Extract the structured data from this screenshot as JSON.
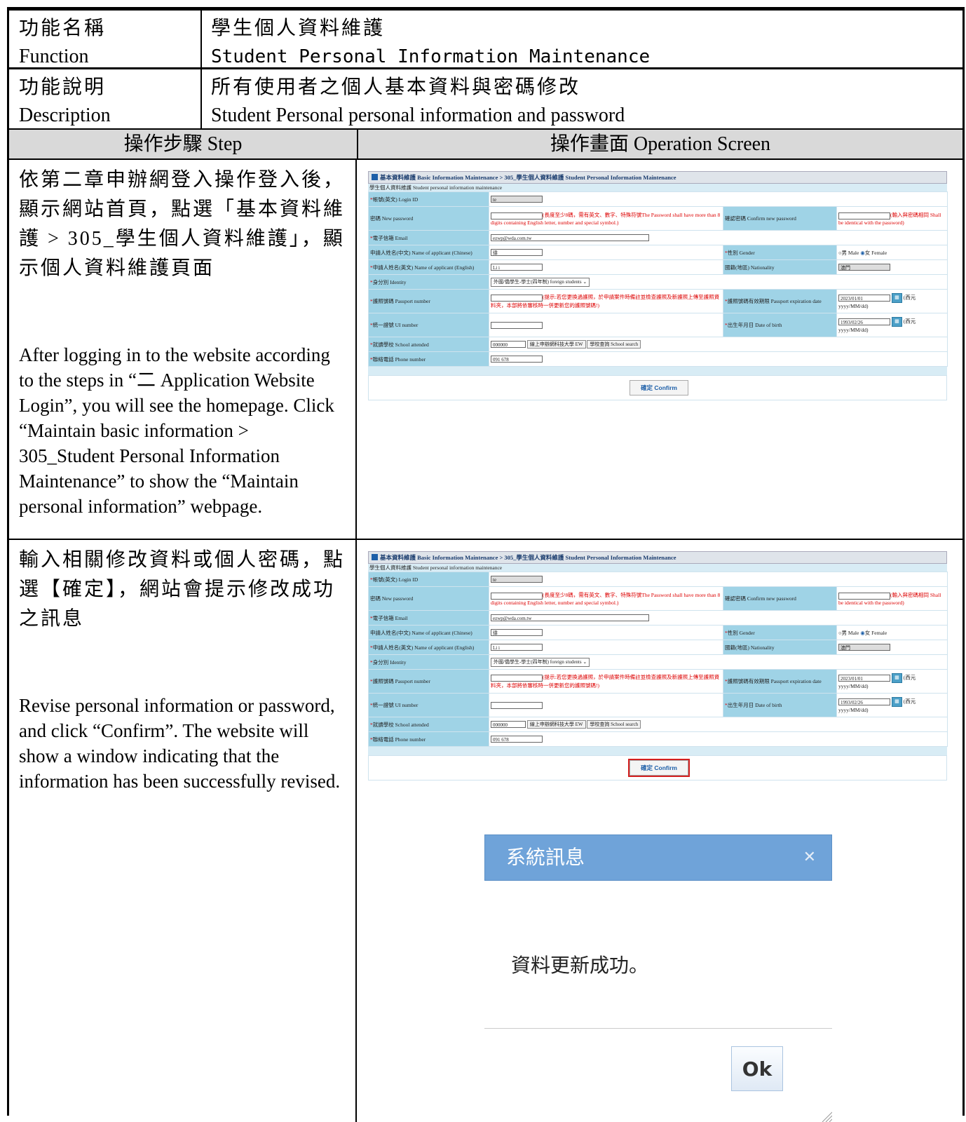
{
  "header": {
    "func_name_label_zh": "功能名稱",
    "func_name_label_en": "Function",
    "func_name_zh": "學生個人資料維護",
    "func_name_en": "Student Personal Information Maintenance",
    "desc_label_zh": "功能說明",
    "desc_label_en": "Description",
    "desc_zh": "所有使用者之個人基本資料與密碼修改",
    "desc_en": "Student Personal personal information and password"
  },
  "columns": {
    "step": "操作步驟 Step",
    "screen": "操作畫面 Operation Screen"
  },
  "steps": [
    {
      "zh": "依第二章申辦網登入操作登入後，顯示網站首頁，點選「基本資料維護 > 305_學生個人資料維護」，顯示個人資料維護頁面",
      "en": "After logging in to the website according to the steps in “二 Application Website Login”, you will see the homepage. Click “Maintain basic information > 305_Student Personal Information Maintenance” to show the “Maintain personal information” webpage."
    },
    {
      "zh": "輸入相關修改資料或個人密碼，點選【確定】，網站會提示修改成功之訊息",
      "en": "Revise personal information or password, and click “Confirm”. The website will show a window indicating that the information has been successfully revised."
    }
  ],
  "form": {
    "breadcrumb": "基本資料維護 Basic Information Maintenance > 305_學生個人資料維護 Student Personal Information Maintenance",
    "subtitle": "學生個人資料維護 Student personal information maintenance",
    "login_id_label": "帳號(英文) Login ID",
    "login_id_value": "te",
    "new_password_label": "密碼 New password",
    "password_hint": "(長度至少8碼，需有英文、數字、特殊符號The Password shall have more than 8 digits containing English letter, number and special symbol.)",
    "confirm_password_label": "確認密碼 Confirm new password",
    "confirm_password_hint": "(輸入與密碼相同 Shall be identical with the password)",
    "email_label": "電子信箱 Email",
    "email_value": "ezwp@wda.com.tw",
    "name_zh_label": "申請人姓名(中文) Name of applicant (Chinese)",
    "name_zh_value": "徫",
    "gender_label": "性別 Gender",
    "gender_male": "男 Male",
    "gender_female": "女 Female",
    "name_en_label": "申請人姓名(英文) Name of applicant (English)",
    "name_en_value": "Li   i",
    "nationality_label": "國籍(地區) Nationality",
    "nationality_value": "澳門",
    "identity_label": "身分別 Identity",
    "identity_value": "外國/僑學生-學士(四年制) foreign students",
    "passport_label": "護照號碼 Passport number",
    "passport_hint": "(提示:若您更換過護照，於申請案件時備註並檢查護照及新護照上傳至護照資料夾，本部將依審核時一併更新您的護照號碼!)",
    "passport_exp_label": "護照號碼有效期限 Passport expiration date",
    "passport_exp_value": "2023/01/01",
    "date_suffix": "(西元",
    "date_format": "yyyy/MM/dd)",
    "ui_label": "統一證號 UI number",
    "dob_label": "出生年月日 Date of birth",
    "dob_value": "1993/02/26",
    "school_label": "就讀學校 School attended",
    "school_code": "000000",
    "school_name": "線上申辦網科技大學 EW",
    "school_search": "學校查詢 School search",
    "phone_label": "聯絡電話 Phone number",
    "phone_value": "091    678",
    "confirm_button": "確定 Confirm"
  },
  "dialog": {
    "title": "系統訊息",
    "message": "資料更新成功。",
    "ok_button": "Ok",
    "close_icon": "close-icon"
  },
  "colors": {
    "dialog_header": "#6fa3d9",
    "form_label_bg": "#9fd3e6",
    "highlight": "#d42020",
    "hint_text": "#dd0000"
  }
}
